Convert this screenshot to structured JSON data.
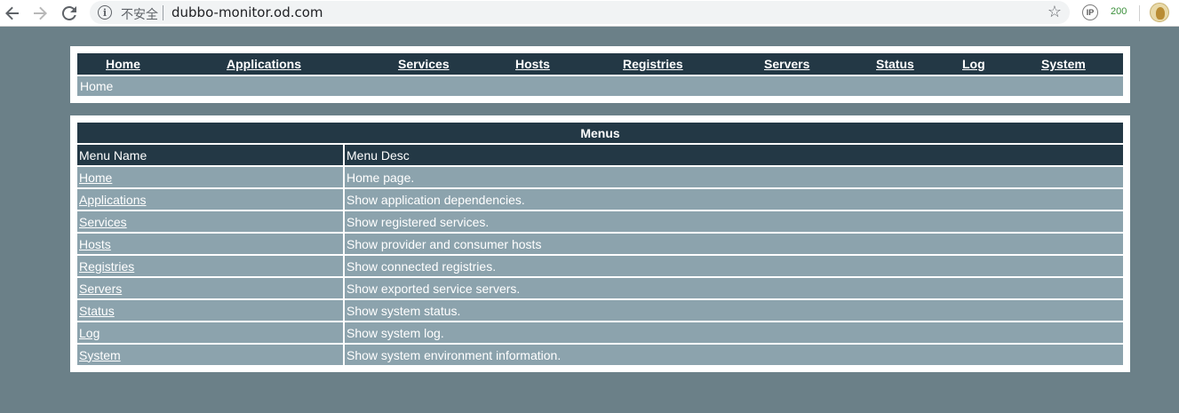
{
  "browser": {
    "insecure_label": "不安全",
    "url": "dubbo-monitor.od.com",
    "ext_ip_label": "IP",
    "ext_count": "200"
  },
  "nav": {
    "items": [
      {
        "label": "Home"
      },
      {
        "label": "Applications"
      },
      {
        "label": "Services"
      },
      {
        "label": "Hosts"
      },
      {
        "label": "Registries"
      },
      {
        "label": "Servers"
      },
      {
        "label": "Status"
      },
      {
        "label": "Log"
      },
      {
        "label": "System"
      }
    ]
  },
  "breadcrumb": "Home",
  "menus": {
    "title": "Menus",
    "columns": [
      "Menu Name",
      "Menu Desc"
    ],
    "rows": [
      {
        "name": "Home",
        "desc": "Home page."
      },
      {
        "name": "Applications",
        "desc": "Show application dependencies."
      },
      {
        "name": "Services",
        "desc": "Show registered services."
      },
      {
        "name": "Hosts",
        "desc": "Show provider and consumer hosts"
      },
      {
        "name": "Registries",
        "desc": "Show connected registries."
      },
      {
        "name": "Servers",
        "desc": "Show exported service servers."
      },
      {
        "name": "Status",
        "desc": "Show system status."
      },
      {
        "name": "Log",
        "desc": "Show system log."
      },
      {
        "name": "System",
        "desc": "Show system environment information."
      }
    ]
  },
  "colors": {
    "background": "#6b8088",
    "header": "#233845",
    "row": "#8ca3ad"
  }
}
